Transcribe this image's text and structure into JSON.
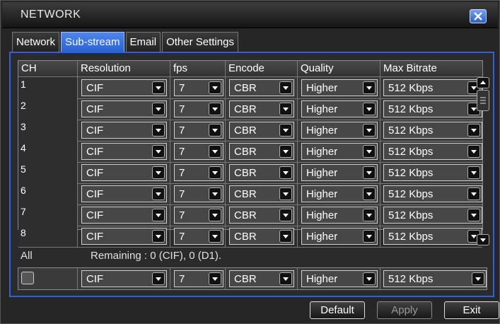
{
  "window": {
    "title": "NETWORK"
  },
  "tabs": [
    {
      "label": "Network",
      "active": false
    },
    {
      "label": "Sub-stream",
      "active": true
    },
    {
      "label": "Email",
      "active": false
    },
    {
      "label": "Other Settings",
      "active": false
    }
  ],
  "table": {
    "headers": [
      "CH",
      "Resolution",
      "fps",
      "Encode",
      "Quality",
      "Max Bitrate"
    ],
    "rows": [
      {
        "ch": "1",
        "resolution": "CIF",
        "fps": "7",
        "encode": "CBR",
        "quality": "Higher",
        "bitrate": "512 Kbps"
      },
      {
        "ch": "2",
        "resolution": "CIF",
        "fps": "7",
        "encode": "CBR",
        "quality": "Higher",
        "bitrate": "512 Kbps"
      },
      {
        "ch": "3",
        "resolution": "CIF",
        "fps": "7",
        "encode": "CBR",
        "quality": "Higher",
        "bitrate": "512 Kbps"
      },
      {
        "ch": "4",
        "resolution": "CIF",
        "fps": "7",
        "encode": "CBR",
        "quality": "Higher",
        "bitrate": "512 Kbps"
      },
      {
        "ch": "5",
        "resolution": "CIF",
        "fps": "7",
        "encode": "CBR",
        "quality": "Higher",
        "bitrate": "512 Kbps"
      },
      {
        "ch": "6",
        "resolution": "CIF",
        "fps": "7",
        "encode": "CBR",
        "quality": "Higher",
        "bitrate": "512 Kbps"
      },
      {
        "ch": "7",
        "resolution": "CIF",
        "fps": "7",
        "encode": "CBR",
        "quality": "Higher",
        "bitrate": "512 Kbps"
      },
      {
        "ch": "8",
        "resolution": "CIF",
        "fps": "7",
        "encode": "CBR",
        "quality": "Higher",
        "bitrate": "512 Kbps"
      }
    ]
  },
  "all": {
    "label": "All",
    "remaining": "Remaining : 0 (CIF), 0 (D1).",
    "resolution": "CIF",
    "fps": "7",
    "encode": "CBR",
    "quality": "Higher",
    "bitrate": "512 Kbps",
    "checked": false
  },
  "buttons": {
    "default": "Default",
    "apply": "Apply",
    "exit": "Exit"
  },
  "colors": {
    "accent": "#2f62d8",
    "tab_active": "#3a74e6"
  }
}
